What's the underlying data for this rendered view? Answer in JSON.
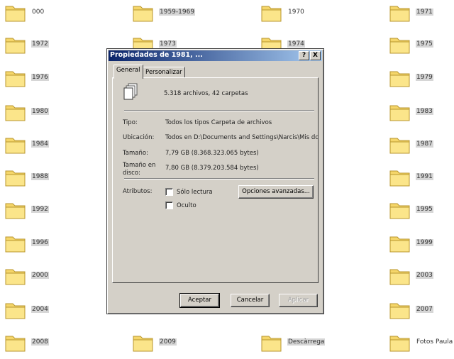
{
  "desktop": {
    "folders": [
      {
        "label": "000"
      },
      {
        "label": "1959-1969"
      },
      {
        "label": "1970"
      },
      {
        "label": "1971"
      },
      {
        "label": "1972"
      },
      {
        "label": "1973"
      },
      {
        "label": "1974"
      },
      {
        "label": "1975"
      },
      {
        "label": "1976"
      },
      {
        "label": "1979"
      },
      {
        "label": "1980"
      },
      {
        "label": "1983"
      },
      {
        "label": "1984"
      },
      {
        "label": "1987"
      },
      {
        "label": "1988"
      },
      {
        "label": "1991"
      },
      {
        "label": "1992"
      },
      {
        "label": "1995"
      },
      {
        "label": "1996"
      },
      {
        "label": "1999"
      },
      {
        "label": "2000"
      },
      {
        "label": "2003"
      },
      {
        "label": "2004"
      },
      {
        "label": "2007"
      },
      {
        "label": "2008"
      },
      {
        "label": "2009"
      },
      {
        "label": "Descàrrega"
      },
      {
        "label": "Fotos Paula"
      }
    ]
  },
  "dialog": {
    "title": "Propiedades de 1981, ...",
    "help_button": "?",
    "close_button": "X",
    "tabs": [
      {
        "label": "General"
      },
      {
        "label": "Personalizar"
      }
    ],
    "summary": "5.318 archivos, 42 carpetas",
    "rows": {
      "tipo_label": "Tipo:",
      "tipo_value": "Todos los tipos Carpeta de archivos",
      "ubicacion_label": "Ubicación:",
      "ubicacion_value": "Todos en D:\\Documents and Settings\\Narcis\\Mis dc",
      "tamano_label": "Tamaño:",
      "tamano_value": "7,79 GB (8.368.323.065 bytes)",
      "disco_label": "Tamaño en disco:",
      "disco_value": "7,80 GB (8.379.203.584 bytes)"
    },
    "attributes": {
      "label": "Atributos:",
      "readonly": "Sólo lectura",
      "hidden": "Oculto",
      "advanced_button": "Opciones avanzadas..."
    },
    "buttons": {
      "ok": "Aceptar",
      "cancel": "Cancelar",
      "apply": "Aplicar"
    },
    "colors": {
      "title_start": "#0a246a",
      "title_end": "#a6caf0",
      "face": "#d4d0c8",
      "folder": "#f5d66a"
    }
  }
}
